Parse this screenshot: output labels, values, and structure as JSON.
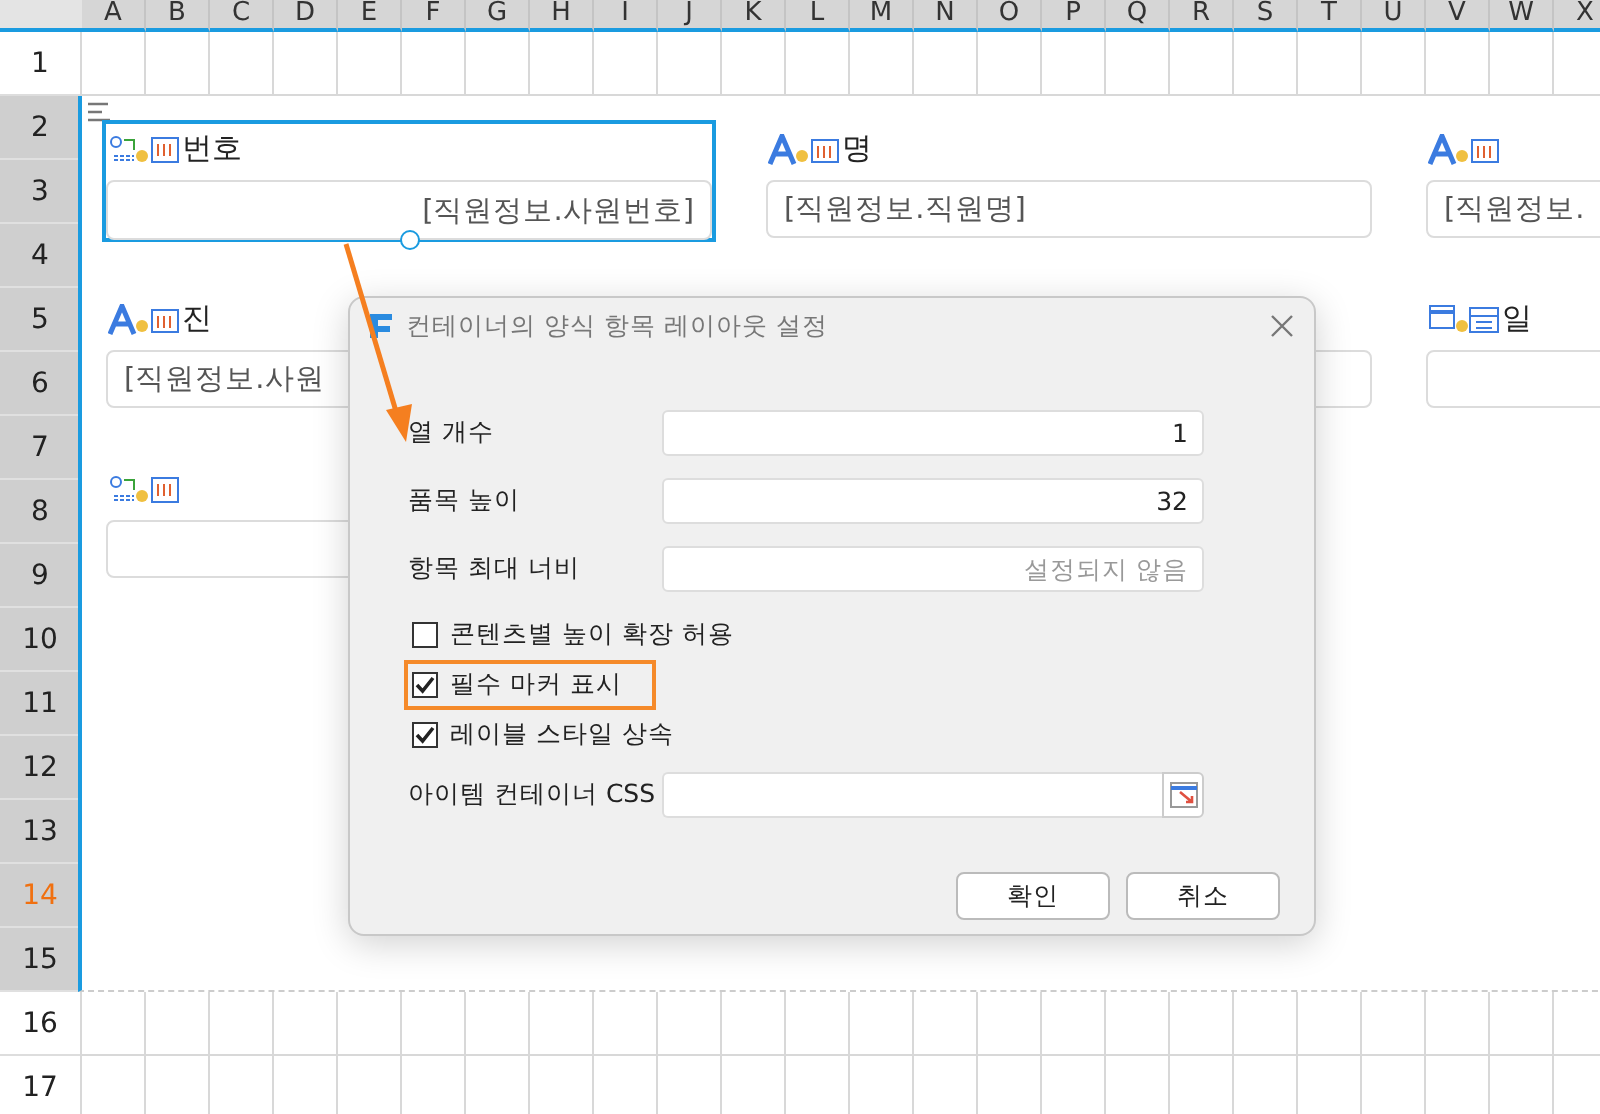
{
  "columns": [
    "A",
    "B",
    "C",
    "D",
    "E",
    "F",
    "G",
    "H",
    "I",
    "J",
    "K",
    "L",
    "M",
    "N",
    "O",
    "P",
    "Q",
    "R",
    "S",
    "T",
    "U",
    "V",
    "W",
    "X"
  ],
  "rows": [
    {
      "label": "1",
      "selected": false,
      "current": false
    },
    {
      "label": "2",
      "selected": true,
      "current": false
    },
    {
      "label": "3",
      "selected": true,
      "current": false
    },
    {
      "label": "4",
      "selected": true,
      "current": false
    },
    {
      "label": "5",
      "selected": true,
      "current": false
    },
    {
      "label": "6",
      "selected": true,
      "current": false
    },
    {
      "label": "7",
      "selected": true,
      "current": false
    },
    {
      "label": "8",
      "selected": true,
      "current": false
    },
    {
      "label": "9",
      "selected": true,
      "current": false
    },
    {
      "label": "10",
      "selected": true,
      "current": false
    },
    {
      "label": "11",
      "selected": true,
      "current": false
    },
    {
      "label": "12",
      "selected": true,
      "current": false
    },
    {
      "label": "13",
      "selected": true,
      "current": false
    },
    {
      "label": "14",
      "selected": true,
      "current": true
    },
    {
      "label": "15",
      "selected": true,
      "current": false
    },
    {
      "label": "16",
      "selected": false,
      "current": false
    },
    {
      "label": "17",
      "selected": false,
      "current": false
    }
  ],
  "container": {
    "items": [
      {
        "kind": "number",
        "label": "번호",
        "value": "[직원정보.사원번호]",
        "selected": true
      },
      {
        "kind": "text",
        "label": "명",
        "value": "[직원정보.직원명]",
        "selected": false
      },
      {
        "kind": "text",
        "value": "[직원정보.",
        "selected": false
      },
      {
        "kind": "text",
        "label": "진",
        "value": "[직원정보.사원",
        "selected": false
      },
      {
        "selected": false
      },
      {
        "kind": "date",
        "label": "일",
        "selected": false
      },
      {
        "kind": "number",
        "selected": false
      }
    ]
  },
  "dialog": {
    "title": "컨테이너의 양식 항목 레이아웃 설정",
    "fields": [
      {
        "label": "열 개수",
        "value": "1"
      },
      {
        "label": "품목 높이",
        "value": "32"
      },
      {
        "label": "항목 최대 너비",
        "placeholder": "설정되지 않음"
      }
    ],
    "checkboxes": [
      {
        "label": "콘텐츠별 높이 확장 허용",
        "checked": false,
        "highlighted": false
      },
      {
        "label": "필수 마커 표시",
        "checked": true,
        "highlighted": true
      },
      {
        "label": "레이블 스타일 상속",
        "checked": true,
        "highlighted": false
      }
    ],
    "css_field": {
      "label": "아이템 컨테이너 CSS"
    },
    "buttons": [
      "확인",
      "취소"
    ]
  }
}
